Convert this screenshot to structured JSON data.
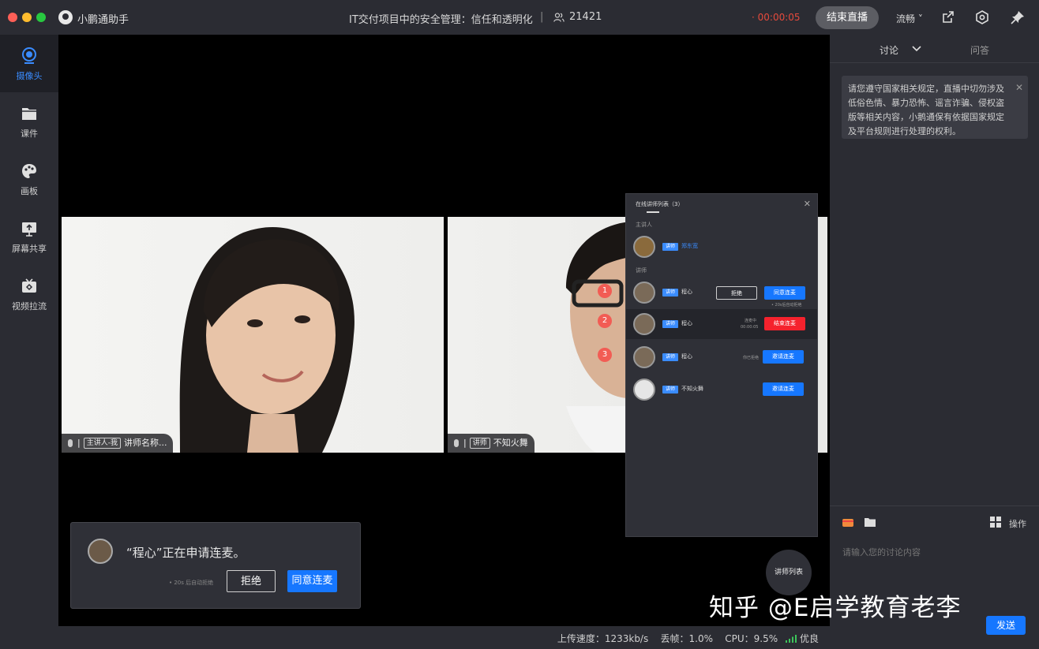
{
  "app": {
    "name": "小鹏通助手"
  },
  "course": {
    "title": "IT交付项目中的安全管理：信任和透明化",
    "separator": "|",
    "viewers": "21421"
  },
  "live": {
    "timer": "· 00:00:05",
    "end_label": "结束直播",
    "quality": "流畅 ˅"
  },
  "sidebar": {
    "items": [
      {
        "label": "摄像头",
        "icon": "camera-icon",
        "active": true
      },
      {
        "label": "课件",
        "icon": "folder-icon"
      },
      {
        "label": "画板",
        "icon": "palette-icon"
      },
      {
        "label": "屏幕共享",
        "icon": "screen-share-icon"
      },
      {
        "label": "视频拉流",
        "icon": "video-pull-icon"
      }
    ]
  },
  "videos": [
    {
      "tag": "主讲人-我",
      "name": "讲师名称..."
    },
    {
      "tag": "讲师",
      "name": "不知火舞"
    }
  ],
  "lecturer_panel": {
    "title": "在线讲师列表（3）",
    "section_host": "主讲人",
    "section_lecturers": "讲师",
    "host": {
      "tag": "讲师",
      "name": "郑东宽"
    },
    "rows": [
      {
        "badge": "1",
        "tag": "讲师",
        "name": "程心",
        "refuse": "拒绝",
        "agree": "同意连麦",
        "note": "• 20s后自动拒绝"
      },
      {
        "badge": "2",
        "tag": "讲师",
        "name": "程心",
        "status": "连麦中",
        "time": "00:00:05",
        "action": "结束连麦"
      },
      {
        "badge": "3",
        "tag": "讲师",
        "name": "程心",
        "status": "你已拒绝",
        "action": "邀请连麦"
      },
      {
        "tag": "讲师",
        "name": "不知火舞",
        "action": "邀请连麦"
      }
    ],
    "fab_label": "讲师列表"
  },
  "request": {
    "text": "“程心”正在申请连麦。",
    "auto": "• 20s 后自动拒绝",
    "refuse": "拒绝",
    "agree": "同意连麦"
  },
  "status_bar": {
    "upload": "上传速度：1233kb/s",
    "drop": "丢帧：1.0%",
    "cpu": "CPU：9.5%",
    "signal": "优良"
  },
  "right_panel": {
    "tab_discuss": "讨论",
    "tab_qa": "问答",
    "notice": "请您遵守国家相关规定，直播中切勿涉及低俗色情、暴力恐怖、谣言诈骗、侵权盗版等相关内容，小鹅通保有依据国家规定及平台规则进行处理的权利。",
    "ops_label": "操作",
    "input_placeholder": "请输入您的讨论内容",
    "send": "发送"
  },
  "watermark": "知乎 @E启学教育老李",
  "colors": {
    "accent": "#1677ff",
    "danger": "#f5222d",
    "timer": "#e64a3c",
    "panel": "#2b2c33"
  }
}
